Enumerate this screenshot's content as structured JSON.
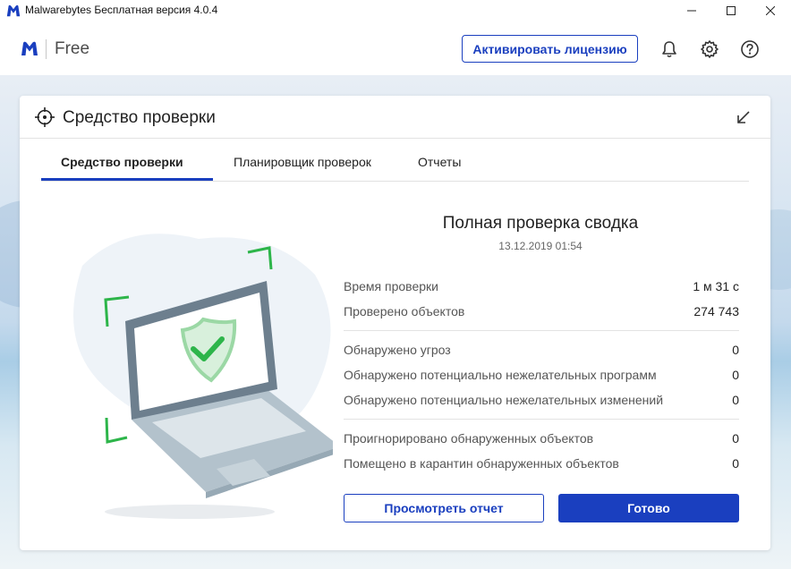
{
  "window": {
    "title": "Malwarebytes Бесплатная версия  4.0.4"
  },
  "header": {
    "edition": "Free",
    "activate_label": "Активировать лицензию",
    "icons": [
      "bell-icon",
      "gear-icon",
      "help-icon"
    ]
  },
  "card": {
    "title": "Средство проверки",
    "tabs": [
      {
        "label": "Средство проверки",
        "active": true
      },
      {
        "label": "Планировщик проверок",
        "active": false
      },
      {
        "label": "Отчеты",
        "active": false
      }
    ]
  },
  "summary": {
    "title": "Полная проверка сводка",
    "date": "13.12.2019 01:54",
    "group1": [
      {
        "label": "Время проверки",
        "value": "1 м 31 с"
      },
      {
        "label": "Проверено объектов",
        "value": "274 743"
      }
    ],
    "group2": [
      {
        "label": "Обнаружено угроз",
        "value": "0"
      },
      {
        "label": "Обнаружено потенциально нежелательных программ",
        "value": "0"
      },
      {
        "label": "Обнаружено потенциально нежелательных изменений",
        "value": "0"
      }
    ],
    "group3": [
      {
        "label": "Проигнорировано обнаруженных объектов",
        "value": "0"
      },
      {
        "label": "Помещено в карантин обнаруженных объектов",
        "value": "0"
      }
    ]
  },
  "buttons": {
    "report_label": "Просмотреть отчет",
    "done_label": "Готово"
  },
  "colors": {
    "brand_blue": "#1a3fbf",
    "check_green": "#2db54a"
  }
}
